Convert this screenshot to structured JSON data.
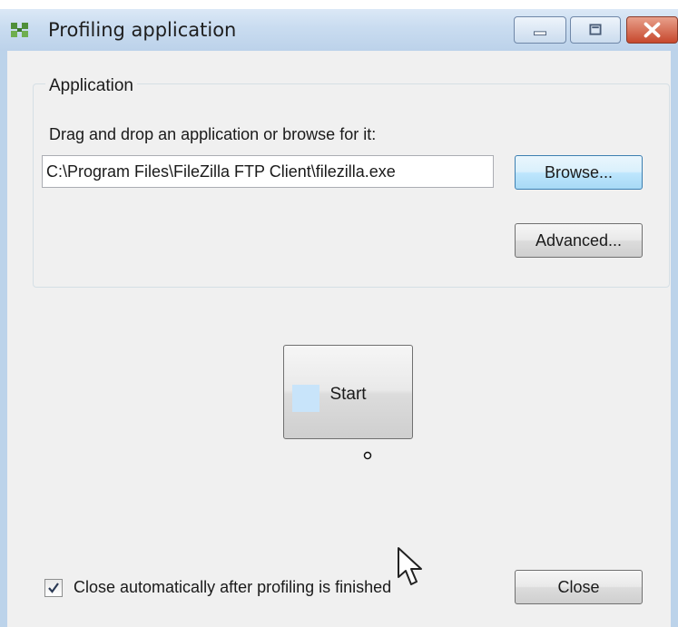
{
  "window": {
    "title": "Profiling application"
  },
  "application_group": {
    "legend": "Application",
    "instruction": "Drag and drop an application or browse for it:",
    "path_value": "C:\\Program Files\\FileZilla FTP Client\\filezilla.exe",
    "browse_label": "Browse...",
    "advanced_label": "Advanced..."
  },
  "start_label": "Start",
  "footer": {
    "auto_close_label": "Close automatically after profiling is finished",
    "auto_close_checked": true,
    "close_label": "Close"
  },
  "icons": {
    "app": "profiler-app-icon",
    "minimize": "minimize-icon",
    "maximize": "maximize-icon",
    "close": "close-x-icon",
    "checkmark": "checkmark-icon",
    "cursor": "mouse-pointer-icon"
  },
  "colors": {
    "titlebar": "#c9dcf0",
    "close_button": "#c7482d",
    "client_background": "#f0f0f0",
    "focused_button_border": "#3c7fb1"
  }
}
